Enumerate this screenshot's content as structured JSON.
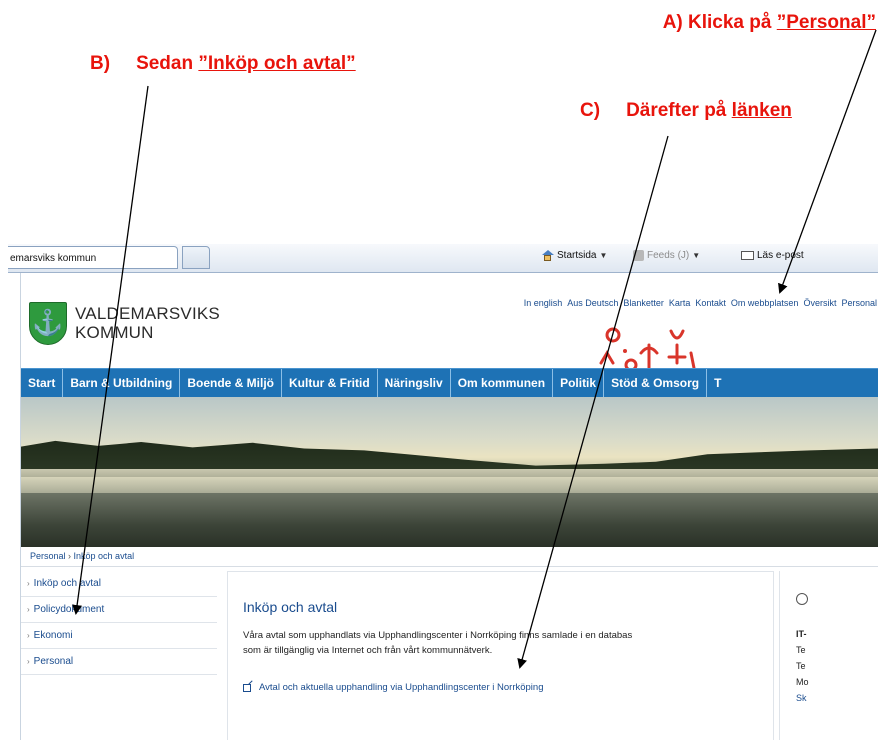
{
  "instructions": {
    "a_prefix": "A) Klicka på ",
    "a_link": "”Personal”",
    "b_prefix": "B)",
    "b_text": "Sedan ",
    "b_link": "”Inköp och avtal”",
    "c_prefix": "C)",
    "c_text": "Därefter på ",
    "c_link": "länken"
  },
  "browser": {
    "tab_title": "emarsviks kommun",
    "home_label": "Startsida",
    "feeds_label": "Feeds (J)",
    "mail_label": "Läs e-post",
    "icons": [
      "home-icon",
      "feed-icon",
      "mail-icon"
    ]
  },
  "site": {
    "logo_line1": "VALDEMARSVIKS",
    "logo_line2": "KOMMUN",
    "top_links": [
      "In english",
      "Aus Deutsch",
      "Blanketter",
      "Karta",
      "Kontakt",
      "Om webbplatsen",
      "Översikt",
      "Personal"
    ],
    "nav": [
      "Start",
      "Barn & Utbildning",
      "Boende & Miljö",
      "Kultur & Fritid",
      "Näringsliv",
      "Om kommunen",
      "Politik",
      "Stöd & Omsorg",
      "T"
    ],
    "breadcrumb": [
      "Personal",
      "Inköp och avtal"
    ],
    "sidebar": [
      "Inköp och avtal",
      "Policydokument",
      "Ekonomi",
      "Personal"
    ],
    "content": {
      "heading": "Inköp och avtal",
      "paragraph": "Våra avtal som upphandlats via Upphandlingscenter i Norrköping finns samlade i en databas som är tillgänglig via Internet och från vårt kommunnätverk.",
      "link": "Avtal och aktuella upphandling via Upphandlingscenter i Norrköping"
    },
    "right": [
      "IT-",
      "Te",
      "Te",
      "Mo",
      "Sk"
    ]
  },
  "colors": {
    "annotation_red": "#e8140c",
    "nav_blue": "#1e72b5",
    "link_blue": "#1a4c8e",
    "logo_green": "#2e9a3e"
  }
}
